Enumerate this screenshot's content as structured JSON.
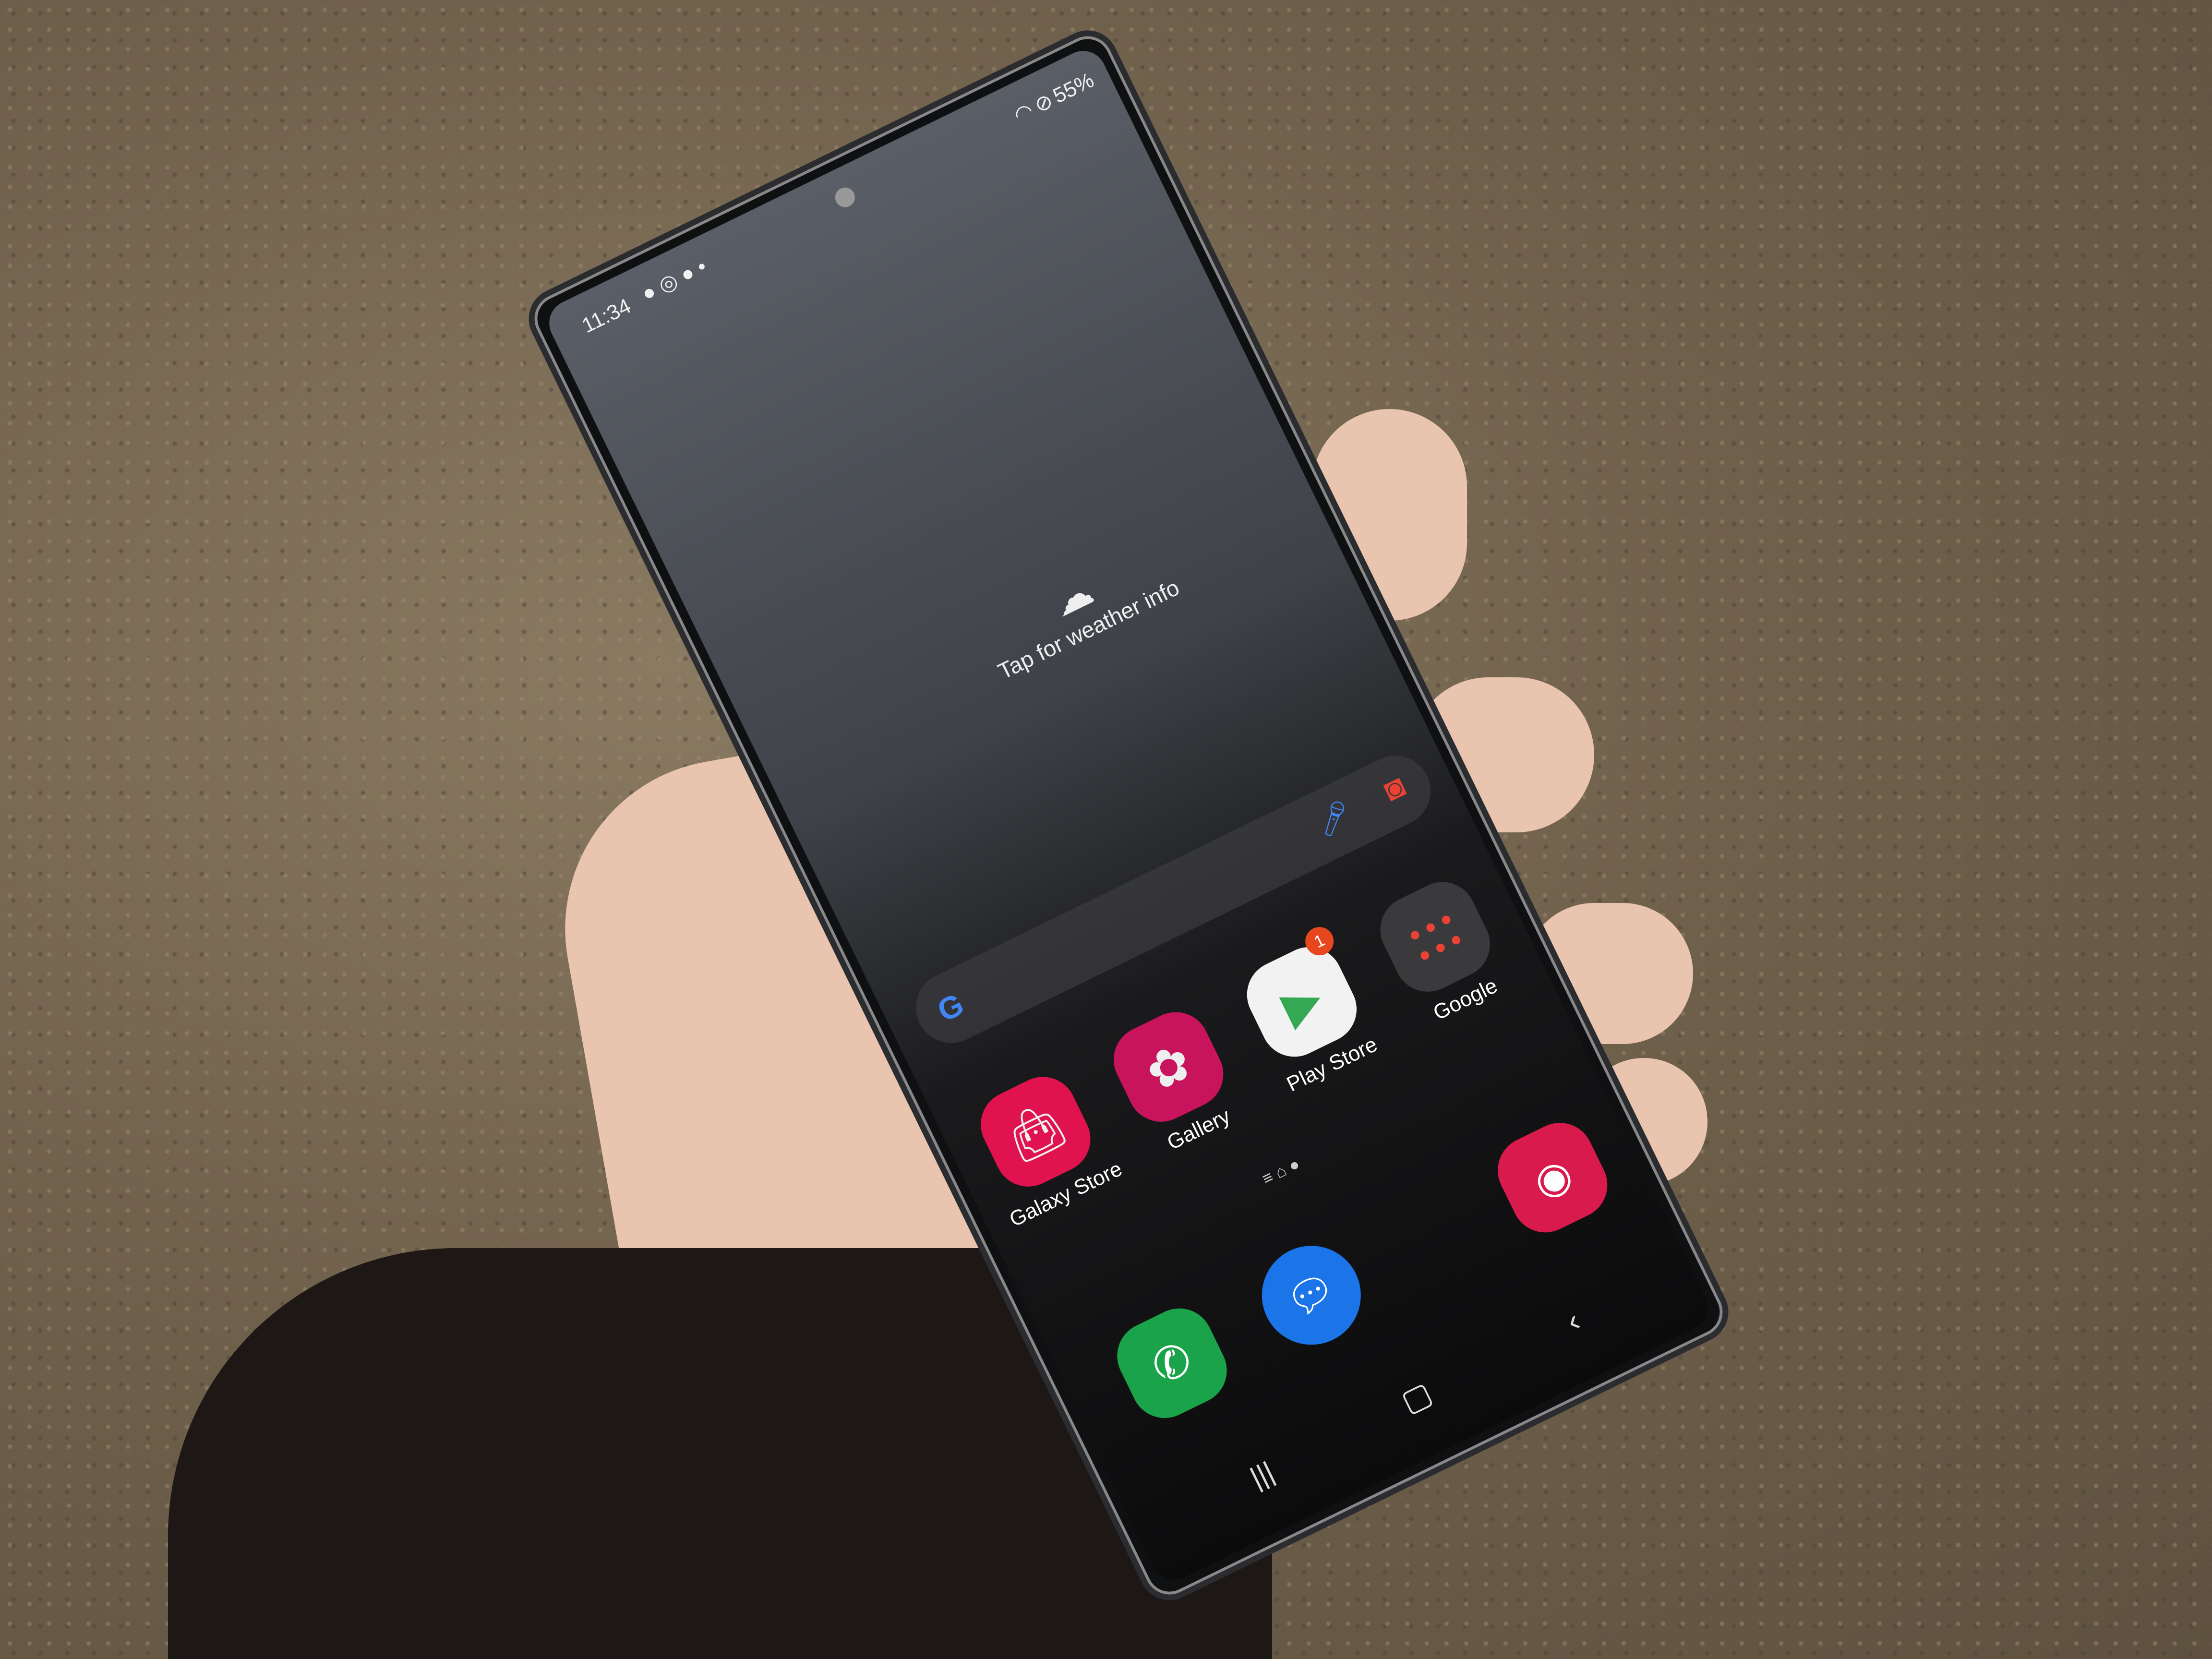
{
  "status_bar": {
    "time": "11:34",
    "battery": "55%"
  },
  "weather_widget": {
    "label": "Tap for weather info"
  },
  "apps": [
    {
      "label": "Galaxy Store",
      "color": "#e0134f"
    },
    {
      "label": "Gallery",
      "color": "#c8145c"
    },
    {
      "label": "Play Store",
      "color": "#f2f2f2",
      "badge": "1"
    },
    {
      "label": "Google",
      "color": "#3a3a3c"
    }
  ],
  "dock": [
    {
      "name": "Phone",
      "color": "#1aa34a"
    },
    {
      "name": "Messages",
      "color": "#1b74e8"
    },
    {
      "name": "Camera",
      "color": "#d81b4c"
    }
  ]
}
